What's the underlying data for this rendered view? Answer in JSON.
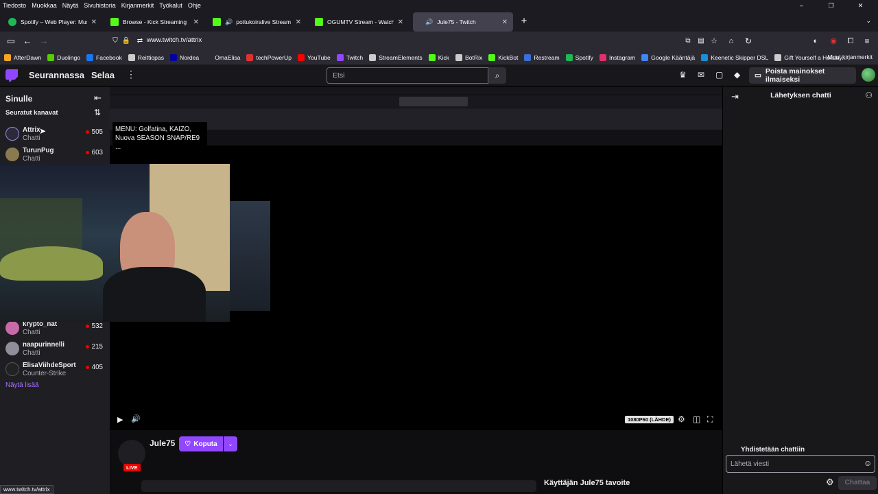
{
  "browser": {
    "menu": [
      "Tiedosto",
      "Muokkaa",
      "Näytä",
      "Sivuhistoria",
      "Kirjanmerkit",
      "Työkalut",
      "Ohje"
    ],
    "tabs": [
      {
        "label": "Spotify – Web Player: Music for",
        "icon_color": "#1db954",
        "audio": false
      },
      {
        "label": "Browse - Kick Streaming",
        "icon_color": "#53fc18",
        "audio": false
      },
      {
        "label": "pottukoiralive Stream - Wat",
        "icon_color": "#53fc18",
        "audio": true
      },
      {
        "label": "OGUMTV Stream - Watch Live o",
        "icon_color": "#53fc18",
        "audio": false
      },
      {
        "label": "Jule75 - Twitch",
        "icon_color": "#9147ff",
        "audio": true,
        "active": true
      }
    ],
    "url": "www.twitch.tv/attrix",
    "bookmarks": [
      {
        "label": "AfterDawn",
        "color": "#f5a623"
      },
      {
        "label": "Duolingo",
        "color": "#58cc02"
      },
      {
        "label": "Facebook",
        "color": "#1877f2"
      },
      {
        "label": "Reittiopas",
        "color": "#cccccc"
      },
      {
        "label": "Nordea",
        "color": "#0000a0"
      },
      {
        "label": "OmaElisa",
        "color": "#2b2a33"
      },
      {
        "label": "techPowerUp",
        "color": "#e03131"
      },
      {
        "label": "YouTube",
        "color": "#ff0000"
      },
      {
        "label": "Twitch",
        "color": "#9147ff"
      },
      {
        "label": "StreamElements",
        "color": "#cccccc"
      },
      {
        "label": "Kick",
        "color": "#53fc18"
      },
      {
        "label": "BotRix",
        "color": "#cccccc"
      },
      {
        "label": "KickBot",
        "color": "#53fc18"
      },
      {
        "label": "Restream",
        "color": "#3a6fd8"
      },
      {
        "label": "Spotify",
        "color": "#1db954"
      },
      {
        "label": "Instagram",
        "color": "#e1306c"
      },
      {
        "label": "Google Kääntäjä",
        "color": "#4285f4"
      },
      {
        "label": "Keenetic Skipper DSL",
        "color": "#1b8ed8"
      },
      {
        "label": "Gift Yourself a Holiday...",
        "color": "#cccccc"
      }
    ],
    "other_bookmarks": "Muut kirjanmerkit",
    "status_url": "www.twitch.tv/attrix"
  },
  "twitch": {
    "nav_following": "Seurannassa",
    "nav_browse": "Selaa",
    "search_placeholder": "Etsi",
    "ad_free_label": "Poista mainokset ilmaiseksi",
    "sidebar": {
      "title": "Sinulle",
      "followed_label": "Seuratut kanavat",
      "channels": [
        {
          "name": "Attrix",
          "category": "Chatti",
          "viewers": "505",
          "color": "#2a2a3a"
        },
        {
          "name": "TurunPug",
          "category": "Chatti",
          "viewers": "603",
          "color": "#8a7a50"
        },
        {
          "name": "krypto_nat",
          "category": "Chatti",
          "viewers": "532",
          "color": "#c86aa8"
        },
        {
          "name": "naapurinnelli",
          "category": "Chatti",
          "viewers": "215",
          "color": "#8f8f99"
        },
        {
          "name": "ElisaViihdeSport",
          "category": "Counter-Strike",
          "viewers": "405",
          "color": "#222222"
        }
      ],
      "show_more": "Näytä lisää",
      "tooltip_line1": "MENU: Golfatina, KAIZO,",
      "tooltip_line2": "Nuova SEASON SNAP/RE9 ..."
    },
    "player": {
      "quality": "1080P60 (LÄHDE)"
    },
    "stream": {
      "streamer": "Jule75",
      "live_badge": "LIVE",
      "cheer_label": "Koputa",
      "goal_title": "Käyttäjän Jule75 tavoite"
    },
    "chat": {
      "title": "Lähetyksen chatti",
      "connecting": "Yhdistetään chattiin",
      "input_placeholder": "Lähetä viesti",
      "send_label": "Chattaa"
    }
  }
}
